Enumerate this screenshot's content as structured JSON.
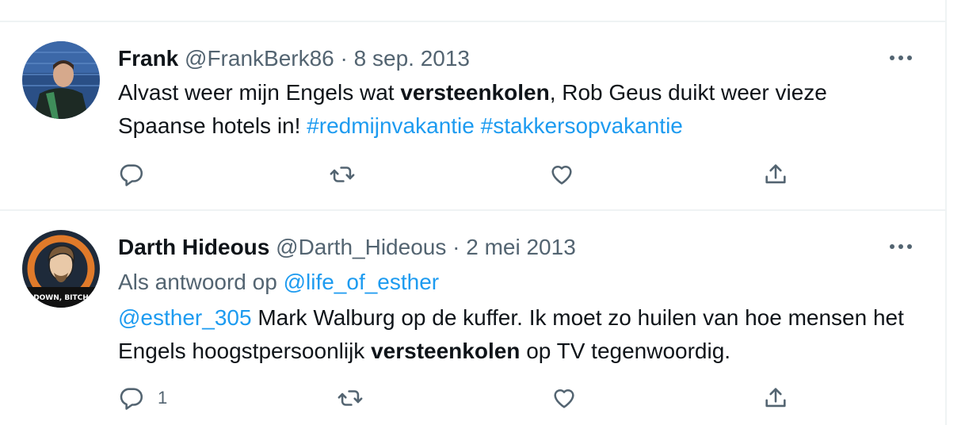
{
  "tweets": [
    {
      "name": "Frank",
      "handle": "@FrankBerk86",
      "sep": "·",
      "date": "8 sep. 2013",
      "text_1": "Alvast weer mijn Engels wat ",
      "bold": "versteenkolen",
      "text_2": ", Rob Geus duikt weer vieze Spaanse hotels in! ",
      "hashtag_1": "#redmijnvakantie",
      "hashtag_2": "#stakkersopvakantie",
      "reply_count": "",
      "icons": {
        "more": "more-dots-icon",
        "reply": "reply-icon",
        "retweet": "retweet-icon",
        "like": "heart-icon",
        "share": "share-icon"
      }
    },
    {
      "name": "Darth Hideous",
      "handle": "@Darth_Hideous",
      "sep": "·",
      "date": "2 mei 2013",
      "reply_prefix": "Als antwoord op ",
      "reply_to": "@life_of_esther",
      "mention": "@esther_305",
      "text_1": " Mark Walburg op de kuffer. Ik moet zo huilen van hoe mensen het Engels hoogstpersoonlijk ",
      "bold": "versteenkolen",
      "text_2": " op TV tegenwoordig.",
      "avatar_text": "DOWN, BITCH",
      "reply_count": "1",
      "icons": {
        "more": "more-dots-icon",
        "reply": "reply-icon",
        "retweet": "retweet-icon",
        "like": "heart-icon",
        "share": "share-icon"
      }
    }
  ],
  "colors": {
    "link": "#1d9bf0",
    "muted": "#536471",
    "text": "#0f1419",
    "divider": "#eff3f4"
  }
}
